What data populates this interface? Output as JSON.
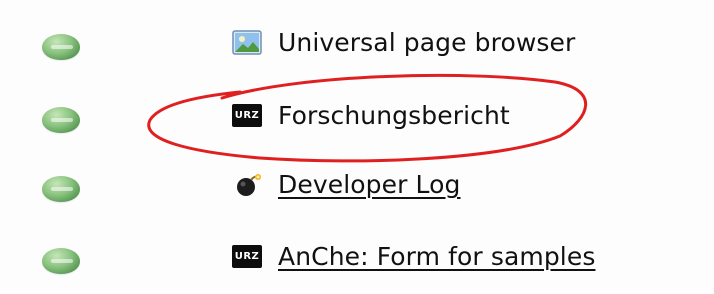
{
  "items": [
    {
      "label": "Universal page browser",
      "icon": "picture-icon",
      "link": false
    },
    {
      "label": "Forschungsbericht",
      "icon": "urz-logo-icon",
      "icon_text": "URZ",
      "link": false,
      "annotated": true
    },
    {
      "label": "Developer Log",
      "icon": "bomb-icon",
      "link": true
    },
    {
      "label": "AnChe: Form for samples",
      "icon": "urz-logo-icon",
      "icon_text": "URZ",
      "link": true
    }
  ],
  "colors": {
    "bullet": "#7bb872",
    "annotation": "#e02020",
    "text": "#111111",
    "urz_bg": "#0d0d0d"
  },
  "bullet_icon": "green-bullet-icon"
}
